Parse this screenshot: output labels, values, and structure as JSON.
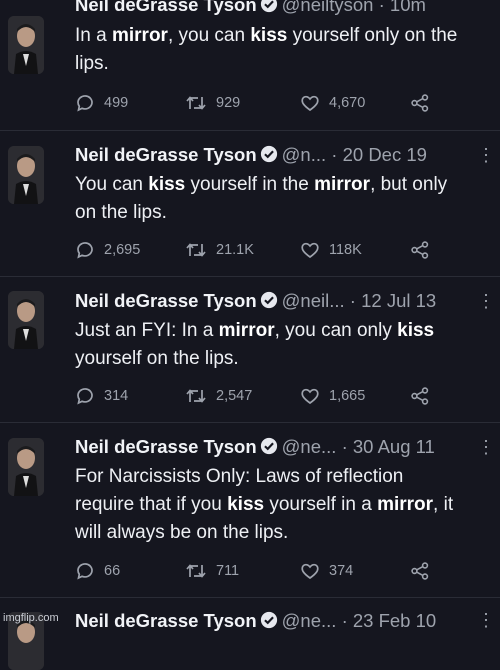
{
  "tweets": [
    {
      "name": "Neil deGrasse Tyson",
      "handle": "@neiltyson",
      "date": "10m",
      "text_parts": [
        "In a ",
        "mirror",
        ", you can ",
        "kiss",
        " yourself only on the",
        "lips."
      ],
      "replies": "499",
      "retweets": "929",
      "likes": "4,670"
    },
    {
      "name": "Neil deGrasse Tyson",
      "handle": "@n...",
      "date": "· 20 Dec 19",
      "text_parts": [
        "You can ",
        "kiss",
        " yourself in the ",
        "mirror",
        ", but only",
        "on the lips."
      ],
      "replies": "2,695",
      "retweets": "21.1K",
      "likes": "118K"
    },
    {
      "name": "Neil deGrasse Tyson",
      "handle": "@neil...",
      "date": "· 12 Jul 13",
      "text_parts": [
        "Just an FYI:  In a ",
        "mirror",
        ", you can only ",
        "kiss",
        "yourself on the lips."
      ],
      "replies": "314",
      "retweets": "2,547",
      "likes": "1,665"
    },
    {
      "name": "Neil deGrasse Tyson",
      "handle": "@ne...",
      "date": "· 30 Aug 11",
      "text_parts": [
        "For Narcissists Only: Laws of reflection",
        "require that if you ",
        "kiss",
        " yourself in a ",
        "mirror",
        ", it",
        "will always be on the lips."
      ],
      "replies": "66",
      "retweets": "711",
      "likes": "374"
    },
    {
      "name": "Neil deGrasse Tyson",
      "handle": "@ne...",
      "date": "· 23 Feb 10"
    }
  ],
  "more_glyph": "⋮",
  "watermark": "imgflip.com",
  "colors": {
    "background": "#15161f",
    "muted": "#9ea3ad",
    "verified_badge": "#e6e8ee"
  }
}
